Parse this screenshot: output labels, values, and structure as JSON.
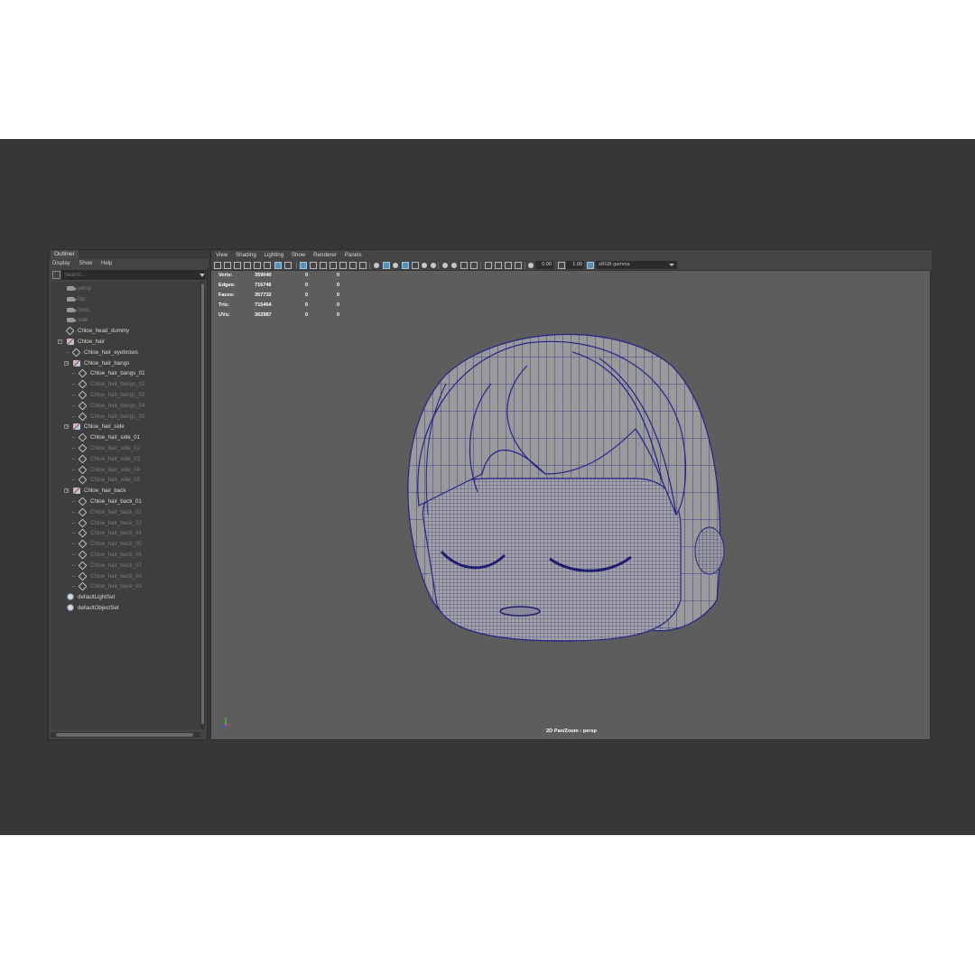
{
  "outliner": {
    "tab": "Outliner",
    "menu": [
      "Display",
      "Show",
      "Help"
    ],
    "search_placeholder": "Search...",
    "items": [
      {
        "label": "persp",
        "icon": "camera-icon",
        "dim": true,
        "level": 0
      },
      {
        "label": "top",
        "icon": "camera-icon",
        "dim": true,
        "level": 0
      },
      {
        "label": "front",
        "icon": "camera-icon",
        "dim": true,
        "level": 0
      },
      {
        "label": "side",
        "icon": "camera-icon",
        "dim": true,
        "level": 0
      },
      {
        "label": "Chloe_head_dummy",
        "icon": "mesh-icon",
        "dim": false,
        "level": 0
      },
      {
        "label": "Chloe_hair",
        "icon": "group-icon",
        "dim": false,
        "level": 0,
        "expander": "-"
      },
      {
        "label": "Chloe_hair_eyebrows",
        "icon": "mesh-icon",
        "dim": false,
        "level": 1
      },
      {
        "label": "Chloe_hair_bangs",
        "icon": "group-icon",
        "dim": false,
        "level": 1,
        "expander": "-"
      },
      {
        "label": "Chloe_hair_bangs_01",
        "icon": "mesh-icon",
        "dim": false,
        "level": 2
      },
      {
        "label": "Chloe_hair_bangs_02",
        "icon": "mesh-icon",
        "dim": true,
        "level": 2
      },
      {
        "label": "Chloe_hair_bangs_03",
        "icon": "mesh-icon",
        "dim": true,
        "level": 2
      },
      {
        "label": "Chloe_hair_bangs_04",
        "icon": "mesh-icon",
        "dim": true,
        "level": 2
      },
      {
        "label": "Chloe_hair_bangs_05",
        "icon": "mesh-icon",
        "dim": true,
        "level": 2
      },
      {
        "label": "Chloe_hair_side",
        "icon": "group-icon",
        "dim": false,
        "level": 1,
        "expander": "-"
      },
      {
        "label": "Chloe_hair_side_01",
        "icon": "mesh-icon",
        "dim": false,
        "level": 2
      },
      {
        "label": "Chloe_hair_side_02",
        "icon": "mesh-icon",
        "dim": true,
        "level": 2
      },
      {
        "label": "Chloe_hair_side_03",
        "icon": "mesh-icon",
        "dim": true,
        "level": 2
      },
      {
        "label": "Chloe_hair_side_04",
        "icon": "mesh-icon",
        "dim": true,
        "level": 2
      },
      {
        "label": "Chloe_hair_side_05",
        "icon": "mesh-icon",
        "dim": true,
        "level": 2
      },
      {
        "label": "Chloe_hair_back",
        "icon": "group-icon",
        "dim": false,
        "level": 1,
        "expander": "-"
      },
      {
        "label": "Chloe_hair_back_01",
        "icon": "mesh-icon",
        "dim": false,
        "level": 2
      },
      {
        "label": "Chloe_hair_back_02",
        "icon": "mesh-icon",
        "dim": true,
        "level": 2
      },
      {
        "label": "Chloe_hair_back_03",
        "icon": "mesh-icon",
        "dim": true,
        "level": 2
      },
      {
        "label": "Chloe_hair_back_04",
        "icon": "mesh-icon",
        "dim": true,
        "level": 2
      },
      {
        "label": "Chloe_hair_back_05",
        "icon": "mesh-icon",
        "dim": true,
        "level": 2
      },
      {
        "label": "Chloe_hair_back_06",
        "icon": "mesh-icon",
        "dim": true,
        "level": 2
      },
      {
        "label": "Chloe_hair_back_07",
        "icon": "mesh-icon",
        "dim": true,
        "level": 2
      },
      {
        "label": "Chloe_hair_back_08",
        "icon": "mesh-icon",
        "dim": true,
        "level": 2
      },
      {
        "label": "Chloe_hair_back_09",
        "icon": "mesh-icon",
        "dim": true,
        "level": 2
      },
      {
        "label": "defaultLightSet",
        "icon": "set-icon",
        "dim": false,
        "level": 0
      },
      {
        "label": "defaultObjectSet",
        "icon": "set-icon",
        "dim": false,
        "level": 0
      }
    ]
  },
  "viewport": {
    "menu": [
      "View",
      "Shading",
      "Lighting",
      "Show",
      "Renderer",
      "Panels"
    ],
    "exposure": "0.00",
    "gamma": "1.00",
    "color_space": "sRGB gamma",
    "camera_label": "2D Pan/Zoom : persp",
    "hud": [
      {
        "label": "Verts:",
        "a": "359040",
        "b": "0",
        "c": "0"
      },
      {
        "label": "Edges:",
        "a": "716746",
        "b": "0",
        "c": "0"
      },
      {
        "label": "Faces:",
        "a": "357732",
        "b": "0",
        "c": "0"
      },
      {
        "label": "Tris:",
        "a": "715464",
        "b": "0",
        "c": "0"
      },
      {
        "label": "UVs:",
        "a": "362987",
        "b": "0",
        "c": "0"
      }
    ]
  },
  "colors": {
    "frame_bg": "#373737",
    "viewport_bg": "#5d5d5d",
    "wireframe": "#2a2a8a",
    "mesh": "#9a9a9a"
  }
}
